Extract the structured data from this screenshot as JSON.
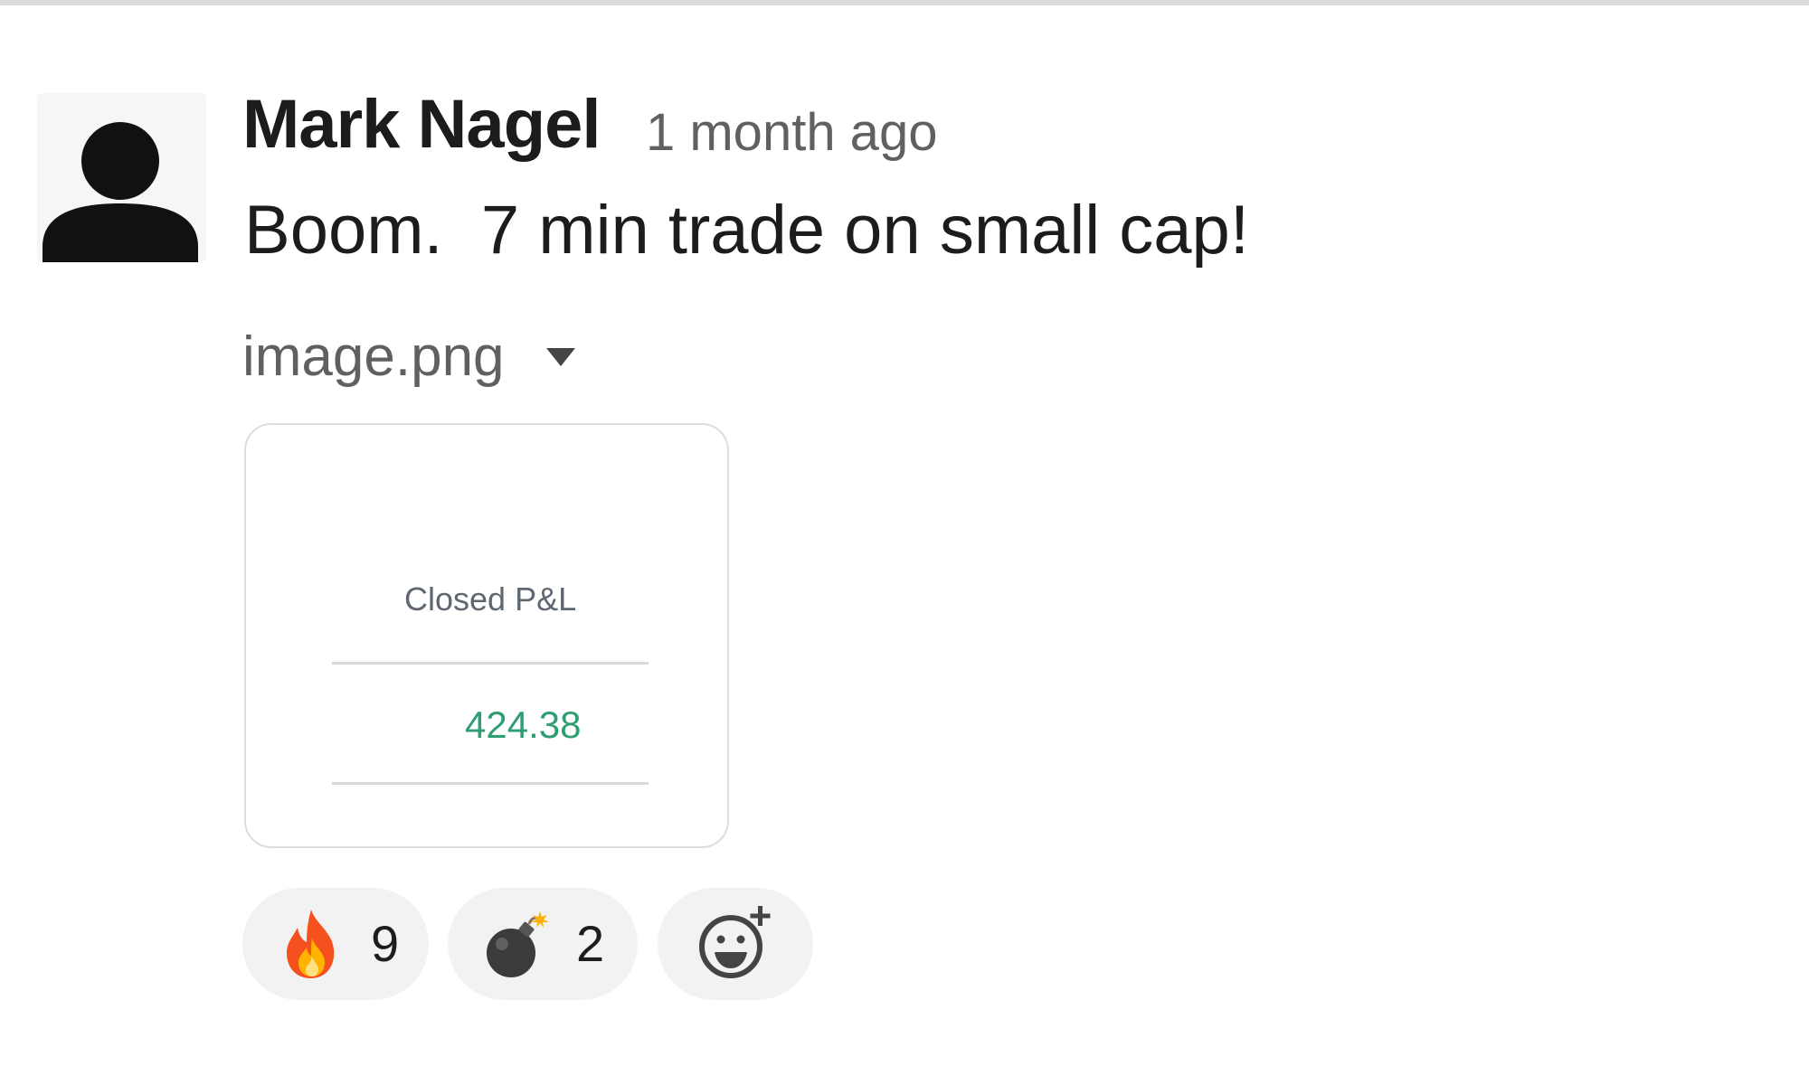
{
  "message": {
    "author": "Mark Nagel",
    "timestamp": "1 month ago",
    "text": "Boom.  7 min trade on small cap!",
    "attachment": {
      "filename": "image.png",
      "preview": {
        "label": "Closed P&L",
        "value": "424.38",
        "value_color": "#2f9e72"
      }
    },
    "reactions": [
      {
        "emoji": "fire-icon",
        "count": "9"
      },
      {
        "emoji": "bomb-icon",
        "count": "2"
      }
    ],
    "add_reaction_icon": "add-reaction-icon"
  },
  "colors": {
    "text_primary": "#1d1c1d",
    "text_secondary": "#616061",
    "reaction_bg": "#f2f2f2"
  }
}
